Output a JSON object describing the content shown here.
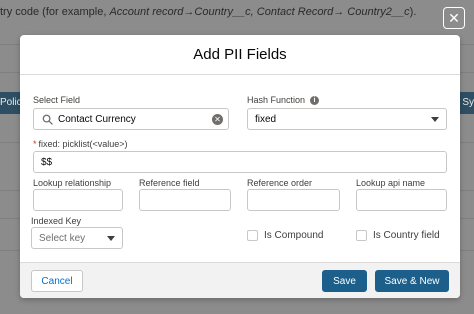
{
  "background": {
    "instruction_prefix": "try code (for example, ",
    "instruction_example1": "Account record",
    "instruction_arrow1": "→",
    "instruction_example2": "Country__c, Contact Record",
    "instruction_arrow2": "→",
    "instruction_example3": " Country2__c",
    "instruction_suffix": ").",
    "bar_left_label": "Polic",
    "bar_right_label": "Sy"
  },
  "modal": {
    "title": "Add PII Fields",
    "select_field": {
      "label": "Select Field",
      "value": "Contact Currency",
      "search_icon": "search-icon",
      "clear_icon": "clear-icon"
    },
    "hash_function": {
      "label": "Hash Function",
      "info_icon": "info-icon",
      "value": "fixed"
    },
    "fixed_picklist": {
      "required_marker": "*",
      "label": "fixed: picklist(<value>)",
      "value": "$$"
    },
    "lookup_relationship": {
      "label": "Lookup relationship",
      "value": ""
    },
    "reference_field": {
      "label": "Reference field",
      "value": ""
    },
    "reference_order": {
      "label": "Reference order",
      "value": ""
    },
    "lookup_api_name": {
      "label": "Lookup api name",
      "value": ""
    },
    "indexed_key": {
      "label": "Indexed Key",
      "placeholder": "Select key"
    },
    "is_compound": {
      "label": "Is Compound",
      "checked": false
    },
    "is_country_field": {
      "label": "Is Country field",
      "checked": false
    },
    "footer": {
      "cancel_label": "Cancel",
      "save_label": "Save",
      "save_new_label": "Save & New"
    }
  },
  "close_icon_glyph": "✕",
  "colors": {
    "brand_button": "#1b5f8a",
    "backdrop": "#8c8c8c",
    "header_bar": "#2e4e63"
  }
}
